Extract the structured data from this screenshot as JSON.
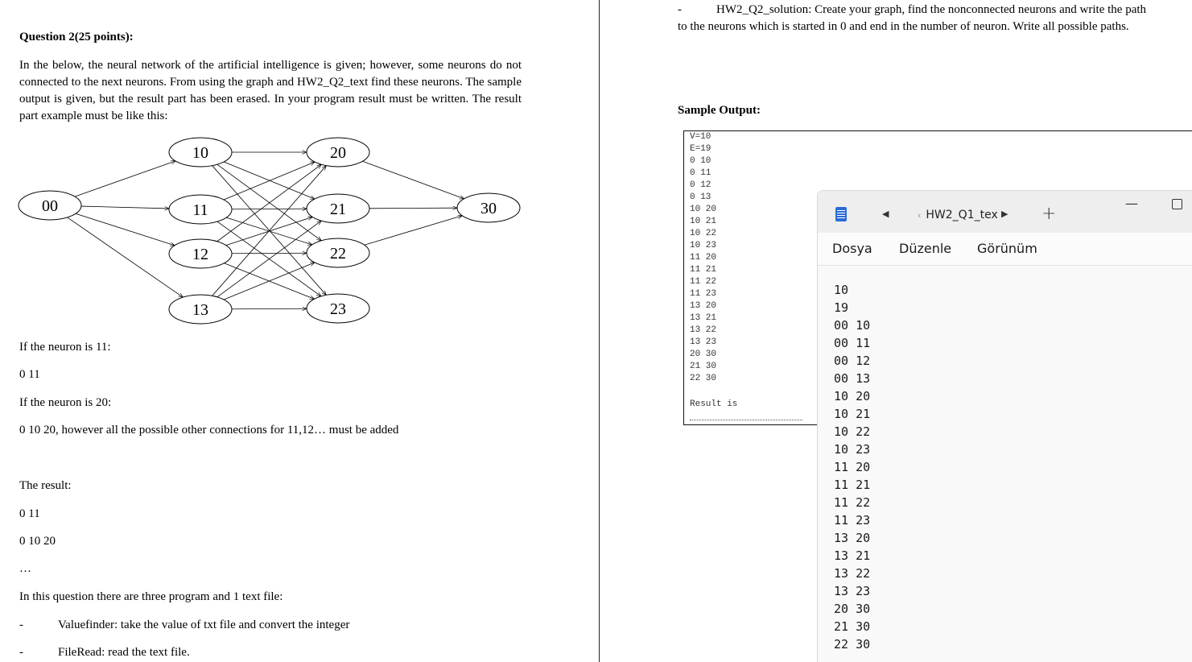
{
  "left_doc": {
    "heading": "Question 2(25 points):",
    "paragraph": "In the below, the neural network of the artificial intelligence is given; however, some neurons do not connected to the next neurons. From using the graph and HW2_Q2_text find these neurons. The sample output is given, but the result part has been erased. In your program result must be written. The result part example must be like this:",
    "graph": {
      "nodes": [
        "00",
        "10",
        "11",
        "12",
        "13",
        "20",
        "21",
        "22",
        "23",
        "30"
      ]
    },
    "line1": "If the neuron is 11:",
    "line2": "0 11",
    "line3": "If the neuron is 20:",
    "line4": "0 10 20, however all the possible other connections for 11,12… must be added",
    "result_label": "The result:",
    "result1": "0 11",
    "result2": "0 10 20",
    "ellipsis": "…",
    "intro_programs": "In this question there are three program and 1 text file:",
    "bullets": [
      {
        "dash": "-",
        "text": "Valuefinder: take the value of txt file and convert the integer"
      },
      {
        "dash": "-",
        "text": "FileRead: read the text file."
      }
    ]
  },
  "right_doc": {
    "bullet_dash": "-",
    "bullet_line1": "HW2_Q2_solution: Create your graph, find the nonconnected neurons and write the path",
    "bullet_line2": "to the neurons which is started in 0 and end in the number of neuron. Write all possible paths.",
    "sample_output_label": "Sample Output:",
    "code_lines": [
      "V=10",
      "E=19",
      "0 10",
      "0 11",
      "0 12",
      "0 13",
      "10 20",
      "10 21",
      "10 22",
      "10 23",
      "11 20",
      "11 21",
      "11 22",
      "11 23",
      "13 20",
      "13 21",
      "13 22",
      "13 23",
      "20 30",
      "21 30",
      "22 30"
    ],
    "result_text": "Result is"
  },
  "notepad": {
    "tab_title": "HW2_Q1_tex",
    "tab_prefix": "‹",
    "menu": [
      "Dosya",
      "Düzenle",
      "Görünüm"
    ],
    "icons": {
      "app": "notepad-icon",
      "prev": "tab-left-arrow-icon",
      "next": "tab-right-arrow-icon",
      "new_tab": "plus-icon",
      "minimize": "minimize-icon",
      "maximize": "maximize-icon"
    },
    "lines": [
      "10",
      "19",
      "00 10",
      "00 11",
      "00 12",
      "00 13",
      "10 20",
      "10 21",
      "10 22",
      "10 23",
      "11 20",
      "11 21",
      "11 22",
      "11 23",
      "13 20",
      "13 21",
      "13 22",
      "13 23",
      "20 30",
      "21 30",
      "22 30"
    ]
  }
}
